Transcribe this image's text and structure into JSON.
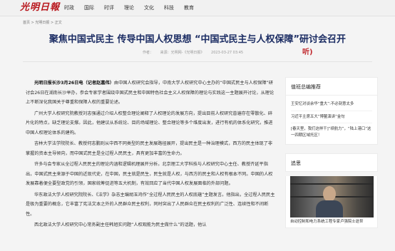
{
  "header": {
    "logo": "光明日報",
    "nav": [
      "时政",
      "国际",
      "时评",
      "理论",
      "文化",
      "科技",
      "教育"
    ]
  },
  "breadcrumb": "首页 > 光明日报 > 正文",
  "article": {
    "title": "聚焦中国式民主  传导中国人权思想  “中国式民主与人权保障”研讨会召开",
    "meta": {
      "author": "作者：",
      "source": "来源：光明网-《光明日报》",
      "date": "2023-03-27 03:45"
    },
    "listen_label": "听",
    "paragraphs": [
      {
        "lead": "光明日报长沙3月26日电（记者赵嘉伟）",
        "text": "由中国人权研究会指导，中南大学人权研究中心主办的“中国式民主与人权保障”研讨会26日在湖南长沙举办，参会专家学者围绕中国式民主和中国特色社会主义人权保障的理论与实践这一主题展开讨论，从理论上不断深化我国关于尊重和保障人权的重要论述。"
      },
      {
        "lead": "",
        "text": "广州大学人权研究院教授刘志强通过介绍人权整合理论阐释了人权理论的发展方向，提出目前人权研究普遍存在零散化、碎片化的特点，缺乏理论支撑。因此，他建议从系统论、目的场域理论、整合理论等多个维度出发，进行有机的体系化研究，推进中国人权理论体系的建构。"
      },
      {
        "lead": "",
        "text": "吉林大学法学院院长、教授何志鹏则从中西不同类型的民主发展路径展开，提出民主是一种治理模式，西方的民主体现了非掌握的资本主导倾向，而中国式民主是全过程人民民主，具有更加丰富的生命力。"
      },
      {
        "lead": "",
        "text": "许多与会专家从全过程人民民主的理论内涵和逻辑机理展开分析。北京理工大学科技与人权研究中心主任、教授齐延平指出，中国式民主来源于中国的近现代史，在中国，民主就是民生，民生就是人权，与西方的民主和人权有根本不同。中国的人权发展靠着便全要型政党的引领，国家统筹促进等五大机制，有效回应了当代中国人权发展面临的外部问题。"
      },
      {
        "lead": "",
        "text": "华东政法大学人权研究院院长、《法学》杂志主编胡玉鸿作“全过程人民民主的人权底蕴”主题发言。他指出，全过程人民民主是极为重要的概念，它丰富了宪法文本之外的人民群众民主权利，同时突出了人民群众在民主权利的广泛性、连续性和不间断性。"
      },
      {
        "lead": "",
        "text": "西北政法大学人权研究中心常务副主任韩旭实问题“人权观能为民主做什么”的话题，他认"
      }
    ]
  },
  "sidebar": {
    "editor_picks_title": "值班总编推荐",
    "editor_picks": [
      "王安忆对谈余华“重大”:不必刻意太多",
      "习近平主席五大“博鳌演讲”金句",
      "[春天里，我们这样干]“续航力”，“陆上港口”这一四期区域托区！"
    ],
    "photo_title": "追思",
    "photo_caption": "自动控制和电力系统工程专家卢强院士逝世"
  }
}
